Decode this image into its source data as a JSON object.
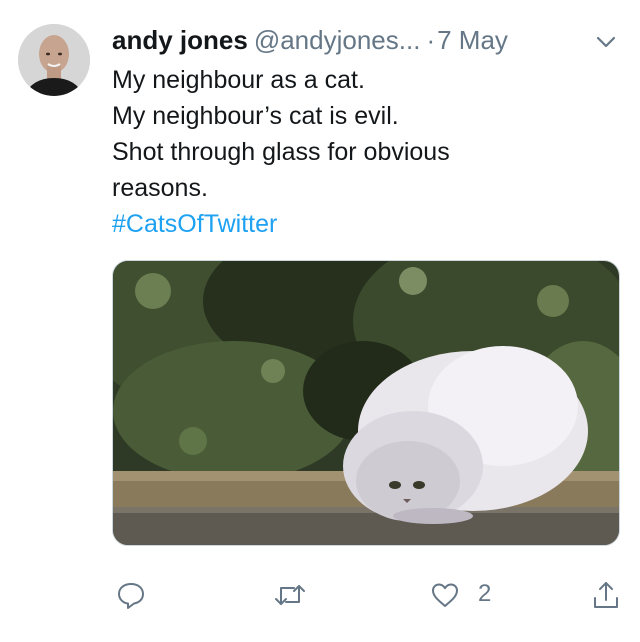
{
  "tweet": {
    "author_name": "andy jones",
    "author_handle": "@andyjones...",
    "separator": "·",
    "date": "7 May",
    "text_lines": [
      "My neighbour as a cat.",
      "My neighbour’s cat is evil.",
      "Shot through glass for obvious",
      "reasons."
    ],
    "hashtag": "#CatsOfTwitter",
    "media_icon": "photo-cat-on-fence",
    "actions": {
      "reply_icon": "reply-icon",
      "retweet_icon": "retweet-icon",
      "like_icon": "heart-icon",
      "like_count": "2",
      "share_icon": "share-icon"
    }
  },
  "colors": {
    "text": "#14171a",
    "muted": "#657786",
    "link": "#1da1f2",
    "background": "#ffffff"
  }
}
